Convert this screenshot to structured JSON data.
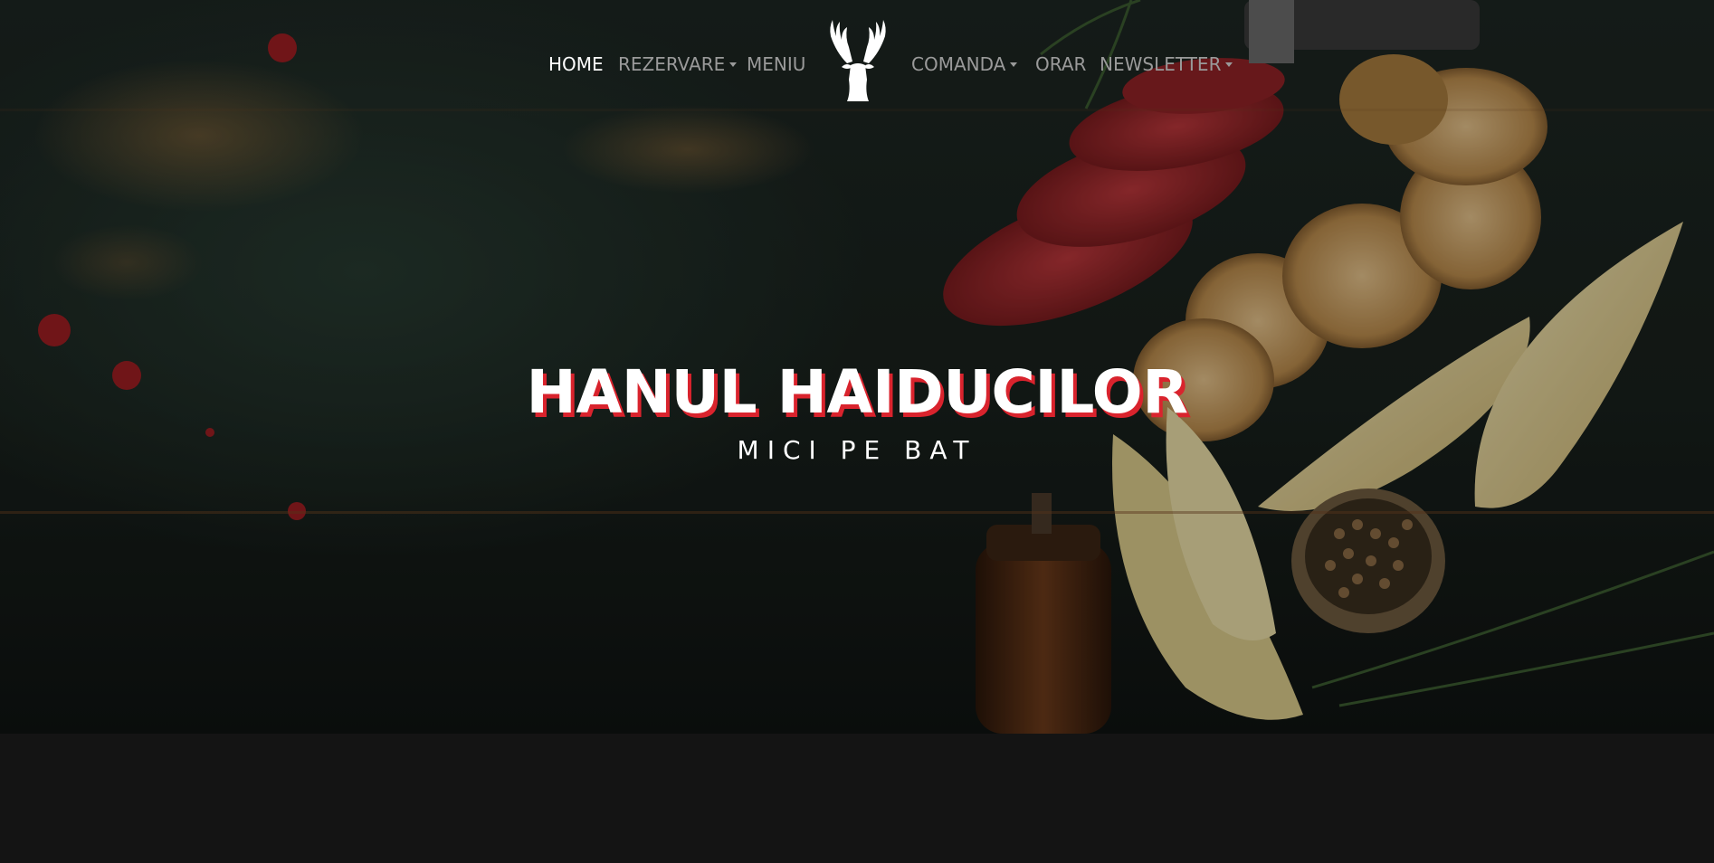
{
  "nav": {
    "items": [
      {
        "label": "HOME",
        "active": true,
        "dropdown": false
      },
      {
        "label": "REZERVARE",
        "active": false,
        "dropdown": true
      },
      {
        "label": "MENIU",
        "active": false,
        "dropdown": false
      },
      {
        "label": "COMANDA",
        "active": false,
        "dropdown": true
      },
      {
        "label": "ORAR",
        "active": false,
        "dropdown": false
      },
      {
        "label": "NEWSLETTER",
        "active": false,
        "dropdown": true
      }
    ],
    "logo_icon": "deer-head-antlers-icon"
  },
  "hero": {
    "title": "HANUL HAIDUCILOR",
    "subtitle": "MICI PE BAT"
  },
  "colors": {
    "accent_red": "#d9232d",
    "nav_active": "#ffffff",
    "nav_inactive": "#9a9a9a",
    "page_background": "#141414"
  }
}
